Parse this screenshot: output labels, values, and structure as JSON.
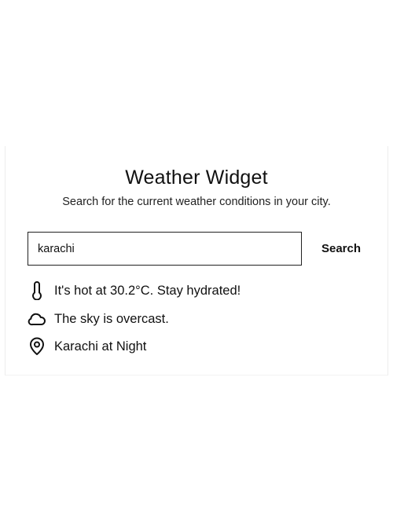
{
  "widget": {
    "title": "Weather Widget",
    "subtitle": "Search for the current weather conditions in your city."
  },
  "search": {
    "value": "karachi",
    "button_label": "Search"
  },
  "results": {
    "temperature_text": "It's hot at 30.2°C. Stay hydrated!",
    "temperature_icon": "thermometer-icon",
    "condition_text": "The sky is overcast.",
    "condition_icon": "cloud-icon",
    "location_text": "Karachi at Night",
    "location_icon": "map-pin-icon"
  },
  "colors": {
    "text": "#111111",
    "input_border": "#222222",
    "background": "#ffffff"
  }
}
